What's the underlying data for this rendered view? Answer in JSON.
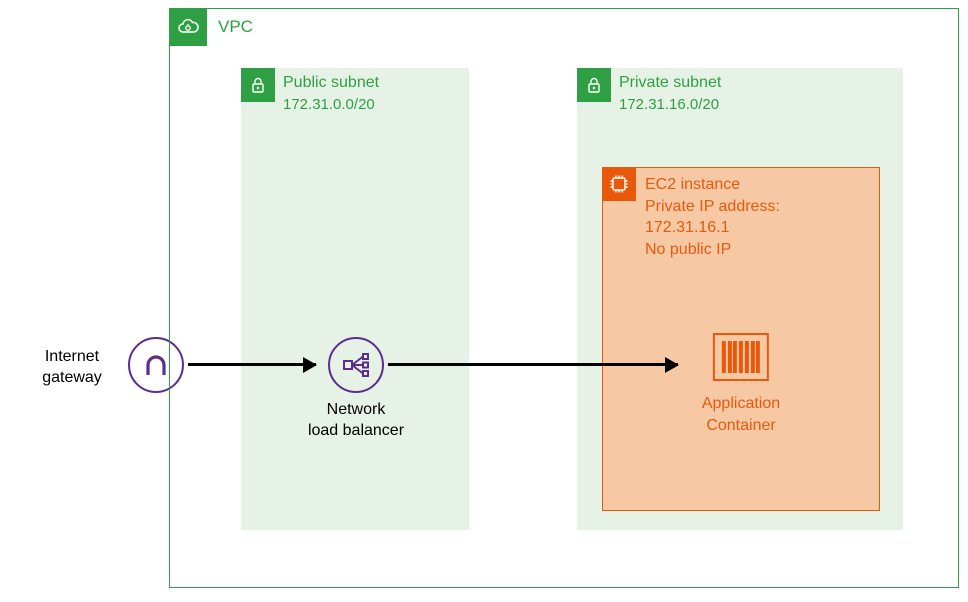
{
  "igw": {
    "label": "Internet\ngateway"
  },
  "vpc": {
    "title": "VPC"
  },
  "public_subnet": {
    "title": "Public subnet",
    "cidr": "172.31.0.0/20"
  },
  "private_subnet": {
    "title": "Private subnet",
    "cidr": "172.31.16.0/20"
  },
  "nlb": {
    "label": "Network\nload balancer"
  },
  "ec2": {
    "title": "EC2 instance",
    "line2": "Private IP address:",
    "ip": "172.31.16.1",
    "line4": "No public IP"
  },
  "container": {
    "label": "Application\nContainer"
  },
  "colors": {
    "green": "#2ea043",
    "orange": "#e8590c",
    "purple": "#5c2d91"
  }
}
